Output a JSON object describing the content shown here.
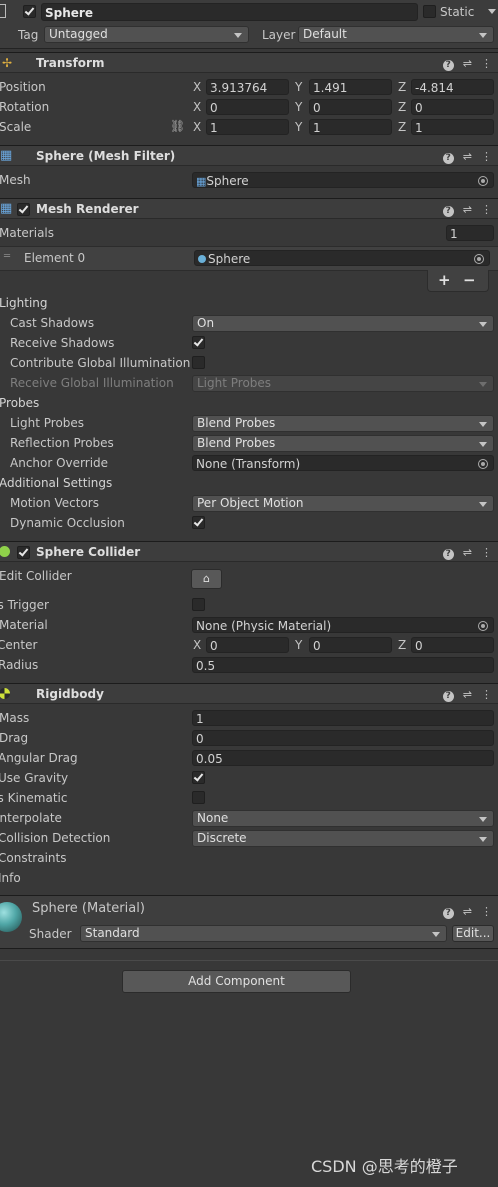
{
  "header": {
    "object_name": "Sphere",
    "static_label": "Static",
    "tag_label": "Tag",
    "tag_value": "Untagged",
    "layer_label": "Layer",
    "layer_value": "Default"
  },
  "transform": {
    "title": "Transform",
    "position_label": "Position",
    "rotation_label": "Rotation",
    "scale_label": "Scale",
    "x": "X",
    "y": "Y",
    "z": "Z",
    "position": [
      "3.913764",
      "1.491",
      "-4.814"
    ],
    "rotation": [
      "0",
      "0",
      "0"
    ],
    "scale": [
      "1",
      "1",
      "1"
    ]
  },
  "mesh_filter": {
    "title": "Sphere (Mesh Filter)",
    "mesh_label": "Mesh",
    "mesh_value": "Sphere"
  },
  "mesh_renderer": {
    "title": "Mesh Renderer",
    "materials_label": "Materials",
    "materials_count": "1",
    "element0_label": "Element 0",
    "element0_value": "Sphere",
    "add_symbol": "+",
    "remove_symbol": "−",
    "lighting_label": "Lighting",
    "cast_shadows_label": "Cast Shadows",
    "cast_shadows_value": "On",
    "receive_shadows_label": "Receive Shadows",
    "contribute_gi_label": "Contribute Global Illumination",
    "receive_gi_label": "Receive Global Illumination",
    "receive_gi_value": "Light Probes",
    "probes_label": "Probes",
    "light_probes_label": "Light Probes",
    "light_probes_value": "Blend Probes",
    "reflection_probes_label": "Reflection Probes",
    "reflection_probes_value": "Blend Probes",
    "anchor_override_label": "Anchor Override",
    "anchor_override_value": "None (Transform)",
    "additional_label": "Additional Settings",
    "motion_vectors_label": "Motion Vectors",
    "motion_vectors_value": "Per Object Motion",
    "dynamic_occlusion_label": "Dynamic Occlusion"
  },
  "sphere_collider": {
    "title": "Sphere Collider",
    "edit_collider_label": "Edit Collider",
    "is_trigger_label": "Is Trigger",
    "material_label": "Material",
    "material_value": "None (Physic Material)",
    "center_label": "Center",
    "center": [
      "0",
      "0",
      "0"
    ],
    "radius_label": "Radius",
    "radius_value": "0.5"
  },
  "rigidbody": {
    "title": "Rigidbody",
    "mass_label": "Mass",
    "mass_value": "1",
    "drag_label": "Drag",
    "drag_value": "0",
    "angular_drag_label": "Angular Drag",
    "angular_drag_value": "0.05",
    "use_gravity_label": "Use Gravity",
    "is_kinematic_label": "Is Kinematic",
    "interpolate_label": "Interpolate",
    "interpolate_value": "None",
    "collision_label": "Collision Detection",
    "collision_value": "Discrete",
    "constraints_label": "Constraints",
    "info_label": "Info"
  },
  "material": {
    "title": "Sphere (Material)",
    "shader_label": "Shader",
    "shader_value": "Standard",
    "edit_label": "Edit..."
  },
  "add_component_label": "Add Component",
  "watermark": "CSDN @思考的橙子",
  "colors": {
    "background": "#383838",
    "header": "#3d3d3d",
    "field": "#2a2a2a",
    "dropdown": "#515151",
    "material_sphere": "#4fa6a6"
  }
}
